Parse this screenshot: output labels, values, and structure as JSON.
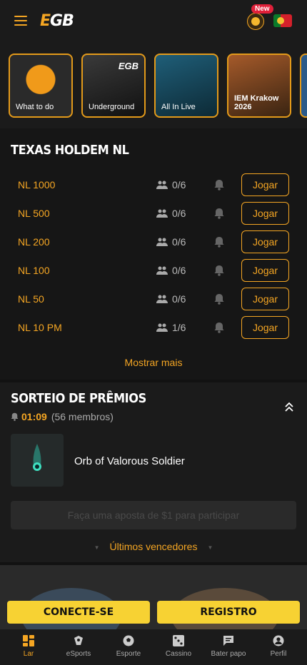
{
  "header": {
    "logo_e": "E",
    "logo_gb": "GB",
    "new_badge": "New"
  },
  "promos": [
    {
      "label": "What to do"
    },
    {
      "label": "Underground",
      "mini_logo": "EGB"
    },
    {
      "label": "All In Live"
    },
    {
      "label": "IEM Krakow 2026"
    }
  ],
  "holdem": {
    "title": "TEXAS HOLDEM NL",
    "tables": [
      {
        "name": "NL 1000",
        "players": "0/6",
        "action": "Jogar"
      },
      {
        "name": "NL 500",
        "players": "0/6",
        "action": "Jogar"
      },
      {
        "name": "NL 200",
        "players": "0/6",
        "action": "Jogar"
      },
      {
        "name": "NL 100",
        "players": "0/6",
        "action": "Jogar"
      },
      {
        "name": "NL 50",
        "players": "0/6",
        "action": "Jogar"
      },
      {
        "name": "NL 10 PM",
        "players": "1/6",
        "action": "Jogar"
      }
    ],
    "more": "Mostrar mais"
  },
  "sorteio": {
    "title": "SORTEIO DE PRÊMIOS",
    "timer": "01:09",
    "members": "(56 membros)",
    "prize": "Orb of Valorous Soldier",
    "participate": "Faça uma aposta de $1 para participar",
    "winners": "Últimos vencedores"
  },
  "auth": {
    "login": "CONECTE-SE",
    "register": "REGISTRO"
  },
  "nav": {
    "items": [
      {
        "label": "Lar",
        "icon": "home-icon"
      },
      {
        "label": "eSports",
        "icon": "esports-icon"
      },
      {
        "label": "Esporte",
        "icon": "soccer-ball-icon"
      },
      {
        "label": "Cassino",
        "icon": "dice-icon"
      },
      {
        "label": "Bater papo",
        "icon": "chat-icon"
      },
      {
        "label": "Perfil",
        "icon": "profile-icon"
      }
    ]
  },
  "colors": {
    "accent": "#f5a623",
    "button_yellow": "#f7d233",
    "background": "#121212"
  }
}
